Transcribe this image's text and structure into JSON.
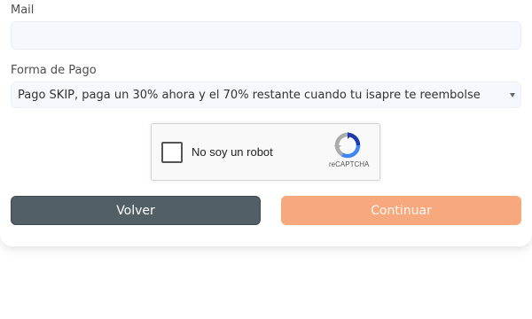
{
  "form": {
    "mail_label": "Mail",
    "mail_value": "",
    "mail_placeholder": "",
    "payment_label": "Forma de Pago",
    "payment_selected": "Pago SKIP, paga un 30% ahora y el 70% restante cuando tu isapre te reembolse"
  },
  "recaptcha": {
    "checkbox_label": "No soy un robot",
    "brand": "reCAPTCHA",
    "icon": "recaptcha-logo-icon"
  },
  "buttons": {
    "back_label": "Volver",
    "continue_label": "Continuar"
  },
  "colors": {
    "back_button": "#525f65",
    "continue_button": "#f7a87c",
    "input_background": "#f5f9fe"
  }
}
